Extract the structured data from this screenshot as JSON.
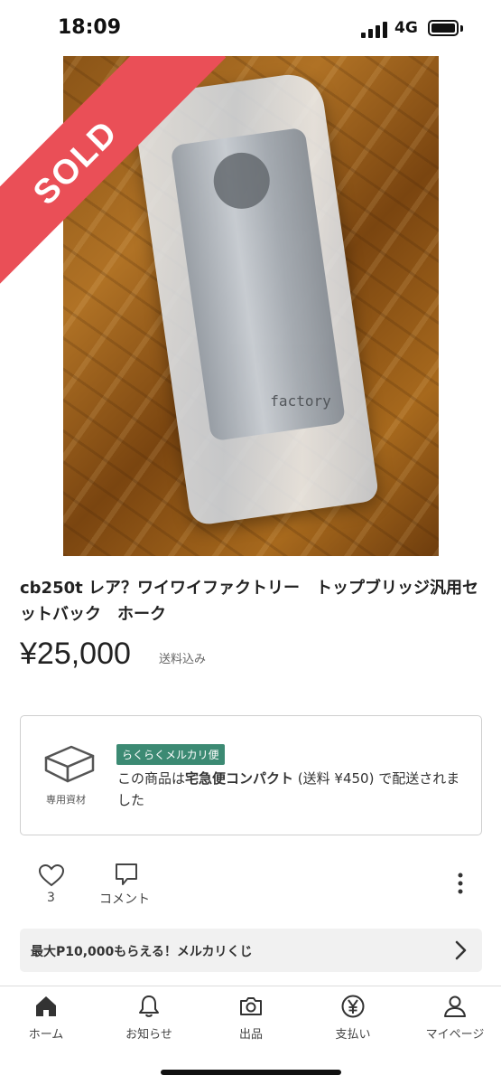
{
  "status_bar": {
    "time": "18:09",
    "network": "4G"
  },
  "photo": {
    "badge": "SOLD",
    "badge_color": "#ea4f57",
    "embossed_text": "factory"
  },
  "item": {
    "title": "cb250t レア？ワイワイファクトリー　トップブリッジ汎用セットバック　ホーク",
    "price": "¥25,000",
    "price_note": "送料込み"
  },
  "shipping": {
    "box_label": "専用資材",
    "method_badge": "らくらくメルカリ便",
    "desc_prefix": "この商品は",
    "desc_method": "宅急便コンパクト",
    "desc_suffix": " (送料 ¥450) で配送されました"
  },
  "actions": {
    "like_count": "3",
    "comment_label": "コメント"
  },
  "lottery": {
    "text": "最大P10,000もらえる！メルカリくじ"
  },
  "tabs": [
    {
      "label": "ホーム",
      "icon": "home-icon"
    },
    {
      "label": "お知らせ",
      "icon": "bell-icon"
    },
    {
      "label": "出品",
      "icon": "camera-icon"
    },
    {
      "label": "支払い",
      "icon": "yen-icon"
    },
    {
      "label": "マイページ",
      "icon": "user-icon"
    }
  ],
  "colors": {
    "accent": "#ea4f57",
    "badge_green": "#3c8a73"
  }
}
